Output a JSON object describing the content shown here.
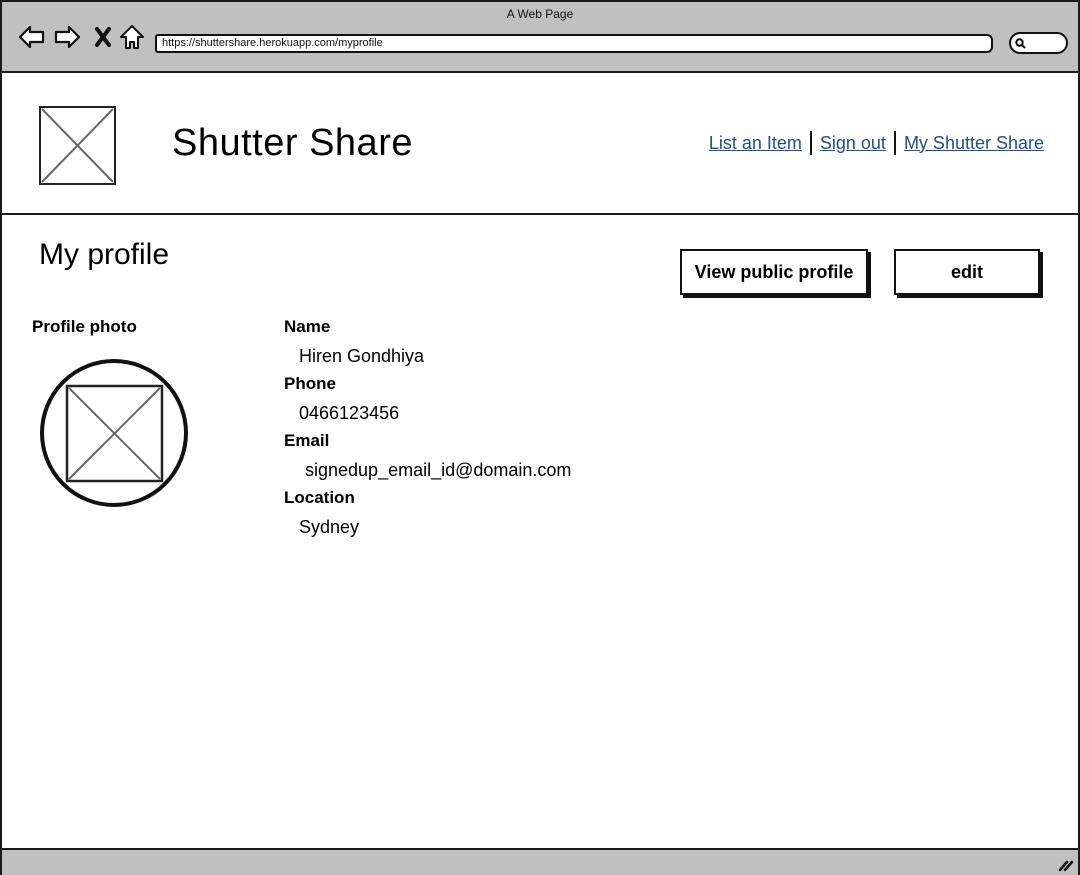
{
  "browser": {
    "window_title": "A Web Page",
    "url": "https://shuttershare.herokuapp.com/myprofile",
    "nav_icons": [
      "back-arrow-icon",
      "forward-arrow-icon",
      "stop-icon",
      "home-icon"
    ],
    "search_icon": "search-icon"
  },
  "header": {
    "logo_icon": "image-placeholder-icon",
    "site_title": "Shutter Share",
    "nav_links": [
      {
        "label": "List an Item"
      },
      {
        "label": "Sign out"
      },
      {
        "label": "My Shutter Share"
      }
    ],
    "link_color": "#1f4f8a"
  },
  "main": {
    "heading": "My profile",
    "buttons": {
      "view_public_profile": "View public profile",
      "edit": "edit"
    },
    "profile_photo_label": "Profile photo",
    "fields": [
      {
        "label": "Name",
        "value": "Hiren Gondhiya"
      },
      {
        "label": "Phone",
        "value": "0466123456"
      },
      {
        "label": "Email",
        "value": "signedup_email_id@domain.com"
      },
      {
        "label": "Location",
        "value": "Sydney"
      }
    ]
  }
}
